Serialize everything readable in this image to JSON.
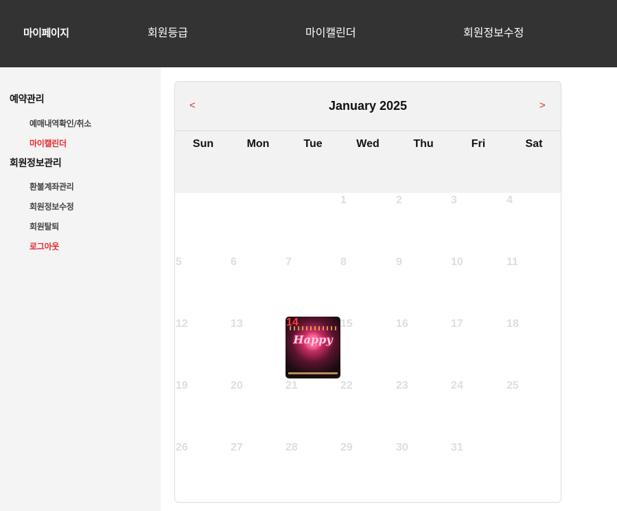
{
  "header": {
    "nav": [
      "마이페이지",
      "회원등급",
      "마이캘린더",
      "회원정보수정"
    ]
  },
  "sidebar": {
    "groups": [
      {
        "title": "예약관리",
        "items": [
          "예매내역확인/취소",
          "마이캘린더"
        ]
      },
      {
        "title": "회원정보관리",
        "items": [
          "환불계좌관리",
          "회원정보수정",
          "회원탈퇴",
          "로그아웃"
        ]
      }
    ],
    "active_item": "마이캘린더",
    "highlight_color": "#e5282d"
  },
  "calendar": {
    "month_title": "January 2025",
    "prev_label": "<",
    "next_label": ">",
    "weekdays": [
      "Sun",
      "Mon",
      "Tue",
      "Wed",
      "Thu",
      "Fri",
      "Sat"
    ],
    "weeks": [
      [
        "",
        "",
        "",
        "1",
        "2",
        "3",
        "4"
      ],
      [
        "5",
        "6",
        "7",
        "8",
        "9",
        "10",
        "11"
      ],
      [
        "12",
        "13",
        "14",
        "15",
        "16",
        "17",
        "18"
      ],
      [
        "19",
        "20",
        "21",
        "22",
        "23",
        "24",
        "25"
      ],
      [
        "26",
        "27",
        "28",
        "29",
        "30",
        "31",
        ""
      ]
    ],
    "event": {
      "day": "14",
      "poster_text": "Happy",
      "icon": "event-poster-image"
    }
  }
}
